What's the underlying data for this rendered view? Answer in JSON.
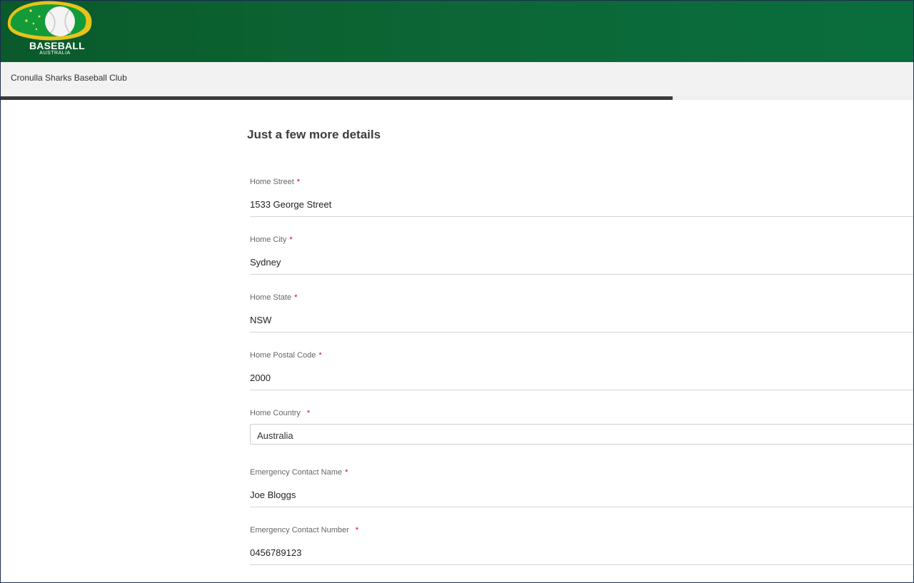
{
  "header": {
    "logo": {
      "title": "BASEBALL",
      "subtitle": "AUSTRALIA",
      "icon": "baseball-logo-icon"
    },
    "colors": {
      "primary": "#0b6433",
      "logo_green": "#12a33a",
      "logo_gold": "#e8c21a"
    }
  },
  "subbar": {
    "club_name": "Cronulla Sharks Baseball Club"
  },
  "progress": {
    "fraction": 0.735,
    "fill_color": "#3a3a3a"
  },
  "form": {
    "title": "Just a few more details",
    "required_marker": "*",
    "fields": [
      {
        "label": "Home Street",
        "value": "1533 George Street"
      },
      {
        "label": "Home City",
        "value": "Sydney"
      },
      {
        "label": "Home State",
        "value": "NSW"
      },
      {
        "label": "Home Postal Code",
        "value": "2000"
      },
      {
        "label": "Home Country",
        "value": "Australia",
        "type": "select"
      },
      {
        "label": "Emergency Contact Name",
        "value": "Joe Bloggs"
      },
      {
        "label": "Emergency Contact Number",
        "value": "0456789123"
      }
    ]
  }
}
